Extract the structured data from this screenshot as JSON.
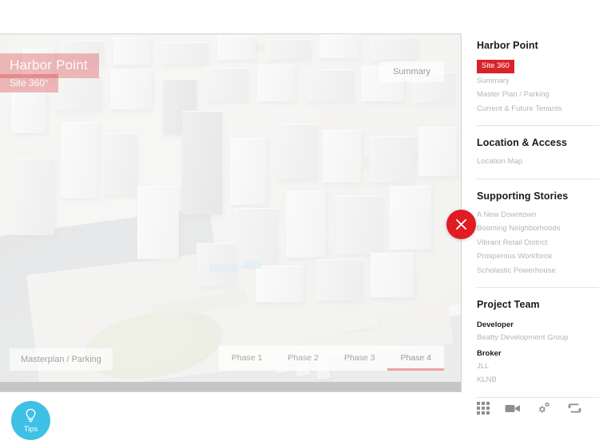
{
  "viewer": {
    "title_badge": "Harbor Point",
    "subtitle_badge": "Site 360°",
    "summary_button": "Summary",
    "masterplan_button": "Masterplan / Parking",
    "phases": [
      {
        "label": "Phase 1",
        "active": false
      },
      {
        "label": "Phase 2",
        "active": false
      },
      {
        "label": "Phase 3",
        "active": false
      },
      {
        "label": "Phase 4",
        "active": true
      }
    ],
    "scene_description": "Aerial 3D rendering of Harbor Point waterfront masterplan"
  },
  "close_button": {
    "icon": "close-icon"
  },
  "tips_button": {
    "label": "Tips",
    "icon": "lightbulb-icon",
    "color": "#3fc0e5"
  },
  "sidebar": {
    "sections": [
      {
        "title": "Harbor Point",
        "items": [
          {
            "label": "Site 360",
            "active": true
          },
          {
            "label": "Summary",
            "active": false
          },
          {
            "label": "Master Plan / Parking",
            "active": false
          },
          {
            "label": "Current & Future Tenants",
            "active": false
          }
        ]
      },
      {
        "title": "Location & Access",
        "items": [
          {
            "label": "Location Map",
            "active": false
          }
        ]
      },
      {
        "title": "Supporting Stories",
        "items": [
          {
            "label": "A New Downtown",
            "active": false
          },
          {
            "label": "Booming Neighborhoods",
            "active": false
          },
          {
            "label": "Vibrant Retail District",
            "active": false
          },
          {
            "label": "Prosperous Workforce",
            "active": false
          },
          {
            "label": "Scholastic Powerhouse",
            "active": false
          }
        ]
      },
      {
        "title": "Project Team",
        "groups": [
          {
            "label": "Developer",
            "entries": [
              "Beatty Development Group"
            ]
          },
          {
            "label": "Broker",
            "entries": [
              "JLL",
              "KLNB"
            ]
          }
        ]
      }
    ]
  },
  "toolbar": {
    "icons": [
      {
        "name": "grid-icon"
      },
      {
        "name": "video-camera-icon"
      },
      {
        "name": "gears-settings-icon"
      },
      {
        "name": "sync-arrows-icon"
      }
    ]
  },
  "colors": {
    "accent_red": "#d8232a",
    "close_red": "#e11b22",
    "tips_blue": "#3fc0e5",
    "text_muted": "#b6b6b6",
    "text_dark": "#1b1b1b"
  }
}
